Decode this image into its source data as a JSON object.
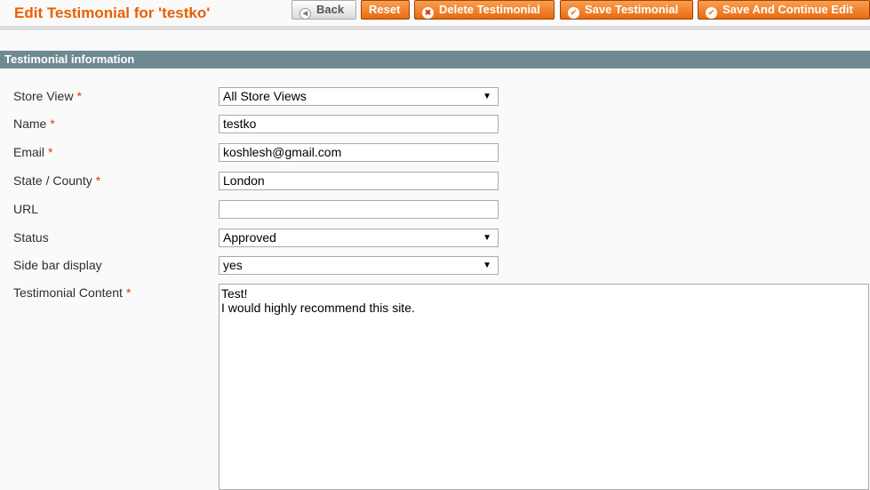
{
  "header": {
    "title": "Edit Testimonial for 'testko'"
  },
  "toolbar": {
    "back_label": "Back",
    "reset_label": "Reset",
    "delete_label": "Delete Testimonial",
    "save_label": "Save Testimonial",
    "save_continue_label": "Save And Continue Edit"
  },
  "section": {
    "title": "Testimonial information"
  },
  "form": {
    "store_view": {
      "label": "Store View",
      "required": "*",
      "value": "All Store Views"
    },
    "name": {
      "label": "Name",
      "required": "*",
      "value": "testko"
    },
    "email": {
      "label": "Email",
      "required": "*",
      "value": "koshlesh@gmail.com"
    },
    "state": {
      "label": "State / County",
      "required": "*",
      "value": "London"
    },
    "url": {
      "label": "URL",
      "value": ""
    },
    "status": {
      "label": "Status",
      "value": "Approved"
    },
    "sidebar": {
      "label": "Side bar display",
      "value": "yes"
    },
    "content": {
      "label": "Testimonial Content",
      "required": "*",
      "lines": [
        "Test!",
        "I would highly recommend this site."
      ]
    }
  },
  "icons": {
    "back": "arrow-left-icon",
    "delete": "delete-icon",
    "save": "check-icon",
    "dropdown": "caret-down-icon"
  }
}
